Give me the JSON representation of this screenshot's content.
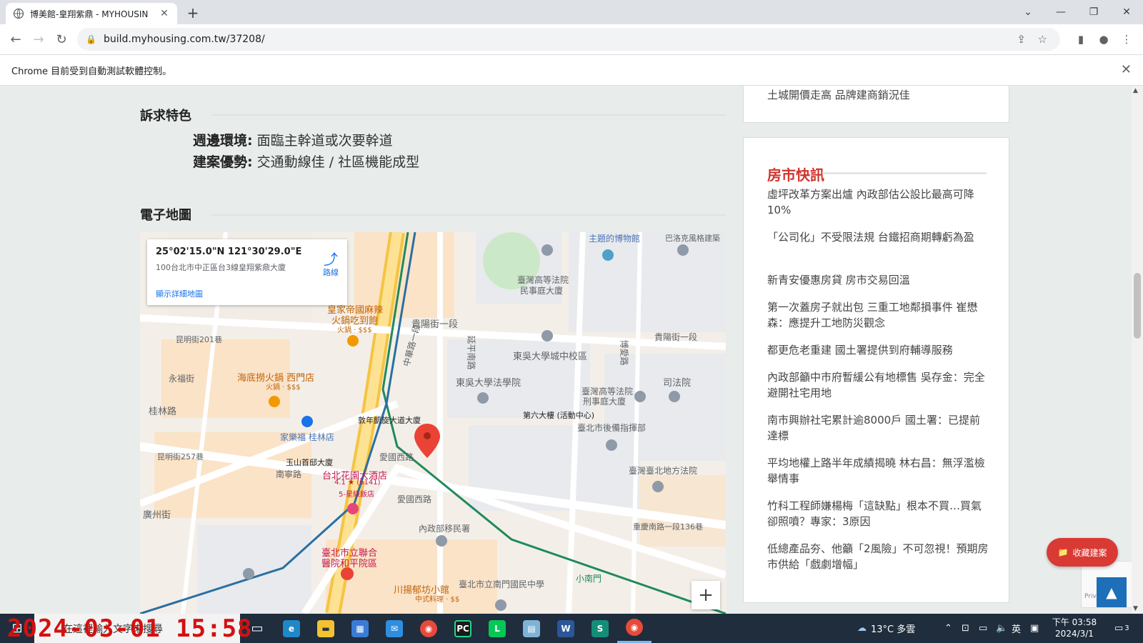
{
  "browser": {
    "tab_title": "博美館-皇翔紫鼎 - MYHOUSIN",
    "url": "build.myhousing.com.tw/37208/",
    "automation_notice": "Chrome 目前受到自動測試軟體控制。"
  },
  "features": {
    "section_title": "訴求特色",
    "rows": [
      {
        "label": "週邊環境:",
        "value": "面臨主幹道或次要幹道"
      },
      {
        "label": "建案優勢:",
        "value": "交通動線佳 / 社區機能成型"
      }
    ]
  },
  "map": {
    "section_title": "電子地圖",
    "coordinates": "25°02'15.0\"N 121°30'29.0\"E",
    "address": "100台北市中正區台3線皇翔紫鼎大廈",
    "route_label": "路線",
    "larger_map_label": "顯示詳細地圖",
    "labels": [
      "主題的博物館",
      "巴洛克風格建築",
      "臺灣高等法院",
      "民事庭大廈",
      "貴陽街一段",
      "皇家帝國麻辣",
      "火鍋吃到飽",
      "火鍋 · $$$",
      "昆明街201巷",
      "東吳大學城中校區",
      "海底撈火鍋 西門店",
      "火鍋 · $$$",
      "永福街",
      "東吳大學法學院",
      "司法院",
      "臺灣高等法院",
      "刑事庭大廈",
      "桂林路",
      "敦年凱旋大道大廈",
      "第六大樓 (活動中心)",
      "臺北市後備指揮部",
      "家樂福 桂林店",
      "昆明街257巷",
      "玉山首邸大廈",
      "愛國西路",
      "台北花園大酒店",
      "4.1 ★ (6141)",
      "5-星級飯店",
      "南寧路",
      "臺灣臺北地方法院",
      "廣州街",
      "內政部移民署",
      "愛國西路",
      "臺北市立聯合",
      "醫院和平院區",
      "川揚郁坊小館",
      "中式料理 · $$",
      "臺北市立南門國民中學",
      "小南門",
      "重慶南路一段136巷",
      "中華路一段",
      "延平南路",
      "博愛路",
      "貴陽街一段"
    ]
  },
  "sidebar": {
    "top_item": "土城開價走高 品牌建商銷況佳",
    "news_title": "房市快訊",
    "news": [
      "虛坪改革方案出爐 內政部估公設比最高可降10%",
      "「公司化」不受限法規 台鐵招商期轉虧為盈",
      "新青安優惠房貸 房市交易回溫",
      "第一次蓋房子就出包 三重工地鄰損事件 崔懋森：應提升工地防災觀念",
      "都更危老重建 國土署提供到府輔導服務",
      "內政部籲中市府暫緩公有地標售 吳存金：完全避開社宅用地",
      "南市興辦社宅累計逾8000戶 國土署：已提前達標",
      "平均地權上路半年成績揭曉 林右昌：無浮濫檢舉情事",
      "竹科工程師嫌楊梅「這缺點」根本不買…買氣卻照噴？專家：3原因",
      "低總產品夯、他籲「2風險」不可忽視！預期房市供給「戲劇增幅」"
    ]
  },
  "floating": {
    "collect_label": "收藏建案",
    "privacy_label": "Privacy"
  },
  "taskbar": {
    "search_placeholder": "在這裡輸入文字來搜尋",
    "weather": "13°C 多雲",
    "ime": "英",
    "time": "下午 03:58",
    "date": "2024/3/1",
    "notification_count": "3"
  },
  "overlay_timestamp": "2024-03-01 15:58"
}
